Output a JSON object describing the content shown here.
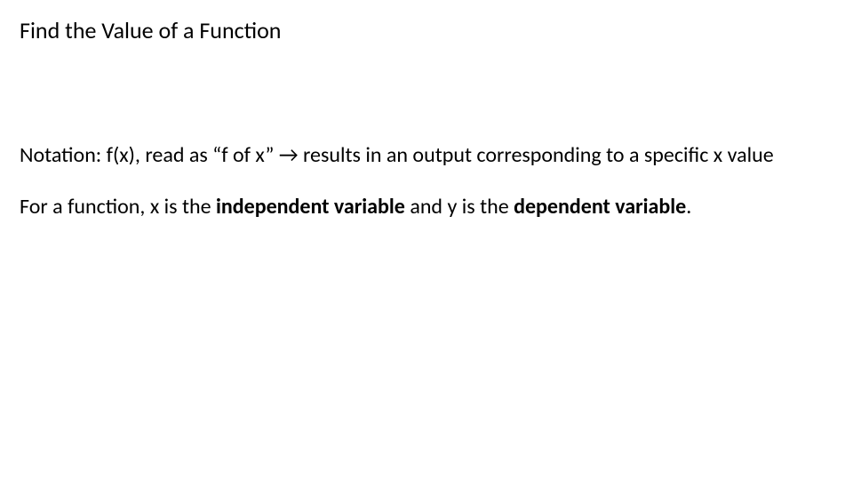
{
  "title": "Find the Value of a Function",
  "notation": {
    "prefix": "Notation: f(x), read as “f of x” ",
    "arrow": "→",
    "suffix": " results in an output corresponding to a specific x value"
  },
  "variables": {
    "p1": "For a function, x is the ",
    "b1": "independent variable",
    "p2": " and y is the ",
    "b2": "dependent variable",
    "p3": "."
  }
}
